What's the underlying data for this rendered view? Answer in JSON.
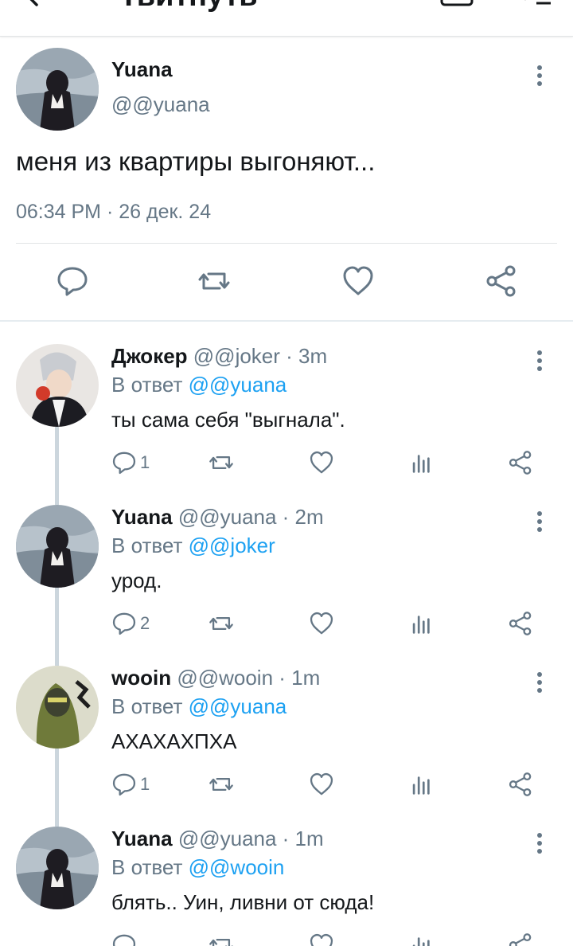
{
  "header": {
    "title": "Твитнуть"
  },
  "main_tweet": {
    "name": "Yuana",
    "handle": "@@yuana",
    "text": "меня из квартиры выгоняют...",
    "time": "06:34 PM · 26 дек. 24"
  },
  "replies": [
    {
      "name": "Джокер",
      "handle": "@@joker · 3m",
      "reply_prefix": "В ответ",
      "reply_to": "@@yuana",
      "text": "ты сама себя \"выгнала\".",
      "reply_count": "1"
    },
    {
      "name": "Yuana",
      "handle": "@@yuana · 2m",
      "reply_prefix": "В ответ",
      "reply_to": "@@joker",
      "text": "урод.",
      "reply_count": "2"
    },
    {
      "name": "wooin",
      "handle": " @@wooin · 1m",
      "reply_prefix": "В ответ",
      "reply_to": "@@yuana",
      "text": "АХАХАХПХА",
      "reply_count": "1"
    },
    {
      "name": "Yuana",
      "handle": "@@yuana · 1m",
      "reply_prefix": "В ответ",
      "reply_to": "@@wooin",
      "text": "блять.. Уин, ливни от сюда!",
      "reply_count": ""
    }
  ],
  "colors": {
    "link": "#1da1f2",
    "muted": "#657786",
    "text": "#14171a"
  }
}
